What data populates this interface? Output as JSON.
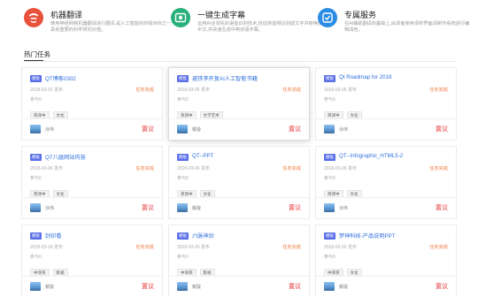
{
  "features": [
    {
      "title": "机器翻译",
      "desc": "使用神经网络机器翻译进行翻译,是人工智能的终极目标之一,具有重要的科学研究价值。",
      "icon": "translate-icon",
      "color": "#e8523d"
    },
    {
      "title": "一键生成字幕",
      "desc": "运用AI业领先的语音识别技术,自动将音频识别成文字并转换成中文,并快速生成中英双语字幕。",
      "icon": "subtitle-icon",
      "color": "#27b07a"
    },
    {
      "title": "专属服务",
      "desc": "在AI辅助翻译的基础上,由译者使用译校界面译制作系统进行编辑润色。",
      "icon": "service-icon",
      "color": "#2c8be3"
    }
  ],
  "section": {
    "title": "热门任务"
  },
  "cards": [
    {
      "badge": "模板",
      "title": "QT博客0302",
      "date": "2018-03-02 发布",
      "status": "任务完成",
      "join": "参与0",
      "tags": [
        "英译中",
        "文化"
      ],
      "user": "涂伟",
      "action": "置议"
    },
    {
      "badge": "模板",
      "title": "避铁李开复AI人工智能书籍",
      "date": "2018-03-05 发布",
      "status": "任务完成",
      "join": "参与0",
      "tags": [
        "英译中",
        "文学艺术"
      ],
      "user": "戴璇",
      "action": "置议"
    },
    {
      "badge": "模板",
      "title": "Qt Roadmap for 2018",
      "date": "2018-03-05 发布",
      "status": "任务完成",
      "join": "参与0",
      "tags": [
        "英译中",
        "文化"
      ],
      "user": "涂伟",
      "action": "置议"
    },
    {
      "badge": "模板",
      "title": "QT八届网站内容",
      "date": "2018-03-06 发布",
      "status": "任务完成",
      "join": "参与0",
      "tags": [
        "英译中",
        "文化"
      ],
      "user": "涂伟",
      "action": "置议"
    },
    {
      "badge": "模板",
      "title": "QT--PPT",
      "date": "2018-03-06 发布",
      "status": "任务完成",
      "join": "参与0",
      "tags": [
        "英译中",
        "文化"
      ],
      "user": "戴璇",
      "action": "置议"
    },
    {
      "badge": "模板",
      "title": "QT--Infographic_HTML5-2",
      "date": "2018-03-06 发布",
      "status": "任务完成",
      "join": "参与0",
      "tags": [
        "英译中",
        "文化"
      ],
      "user": "涂伟",
      "action": "置议"
    },
    {
      "badge": "模板",
      "title": "封印看",
      "date": "2018-03-19 发布",
      "status": "任务完成",
      "join": "参与0",
      "tags": [
        "中译英",
        "影视"
      ],
      "user": "戴璇",
      "action": "置议"
    },
    {
      "badge": "模板",
      "title": "六脉神剑",
      "date": "2018-03-20 发布",
      "status": "任务完成",
      "join": "参与0",
      "tags": [
        "中译英",
        "影视"
      ],
      "user": "戴璇",
      "action": "置议"
    },
    {
      "badge": "模板",
      "title": "梦神科技-产品说明PPT",
      "date": "2018-03-20 发布",
      "status": "任务完成",
      "join": "参与0",
      "tags": [
        "中译英",
        "文化"
      ],
      "user": "戴璇",
      "action": "置议"
    }
  ]
}
